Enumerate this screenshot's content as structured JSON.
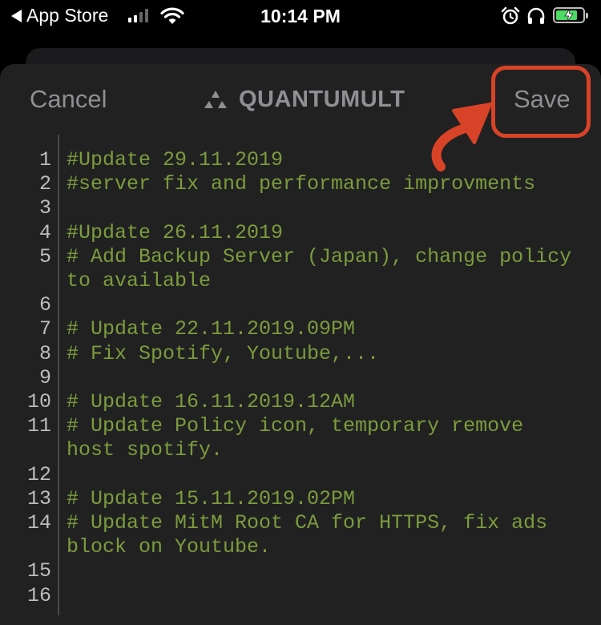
{
  "status_bar": {
    "back_app": "App Store",
    "time": "10:14 PM"
  },
  "nav": {
    "cancel_label": "Cancel",
    "title": "QUANTUMULT",
    "save_label": "Save"
  },
  "colors": {
    "highlight_box": "#d84328",
    "comment_text": "#7b9c3e",
    "nav_text": "#8f8f94"
  },
  "editor": {
    "lines": [
      {
        "n": "1",
        "text": "#Update 29.11.2019"
      },
      {
        "n": "2",
        "text": "#server fix and performance improvments"
      },
      {
        "n": "3",
        "text": ""
      },
      {
        "n": "4",
        "text": "#Update 26.11.2019"
      },
      {
        "n": "5",
        "text": "# Add Backup Server (Japan), change policy",
        "cont": "to available"
      },
      {
        "n": "6",
        "text": ""
      },
      {
        "n": "7",
        "text": "# Update 22.11.2019.09PM"
      },
      {
        "n": "8",
        "text": "# Fix Spotify, Youtube,..."
      },
      {
        "n": "9",
        "text": ""
      },
      {
        "n": "10",
        "text": "# Update 16.11.2019.12AM"
      },
      {
        "n": "11",
        "text": "# Update Policy icon, temporary remove",
        "cont": "host spotify."
      },
      {
        "n": "12",
        "text": ""
      },
      {
        "n": "13",
        "text": "# Update 15.11.2019.02PM"
      },
      {
        "n": "14",
        "text": "# Update MitM Root CA for HTTPS, fix ads",
        "cont": "block on Youtube."
      },
      {
        "n": "15",
        "text": ""
      },
      {
        "n": "16",
        "text": ""
      }
    ]
  }
}
